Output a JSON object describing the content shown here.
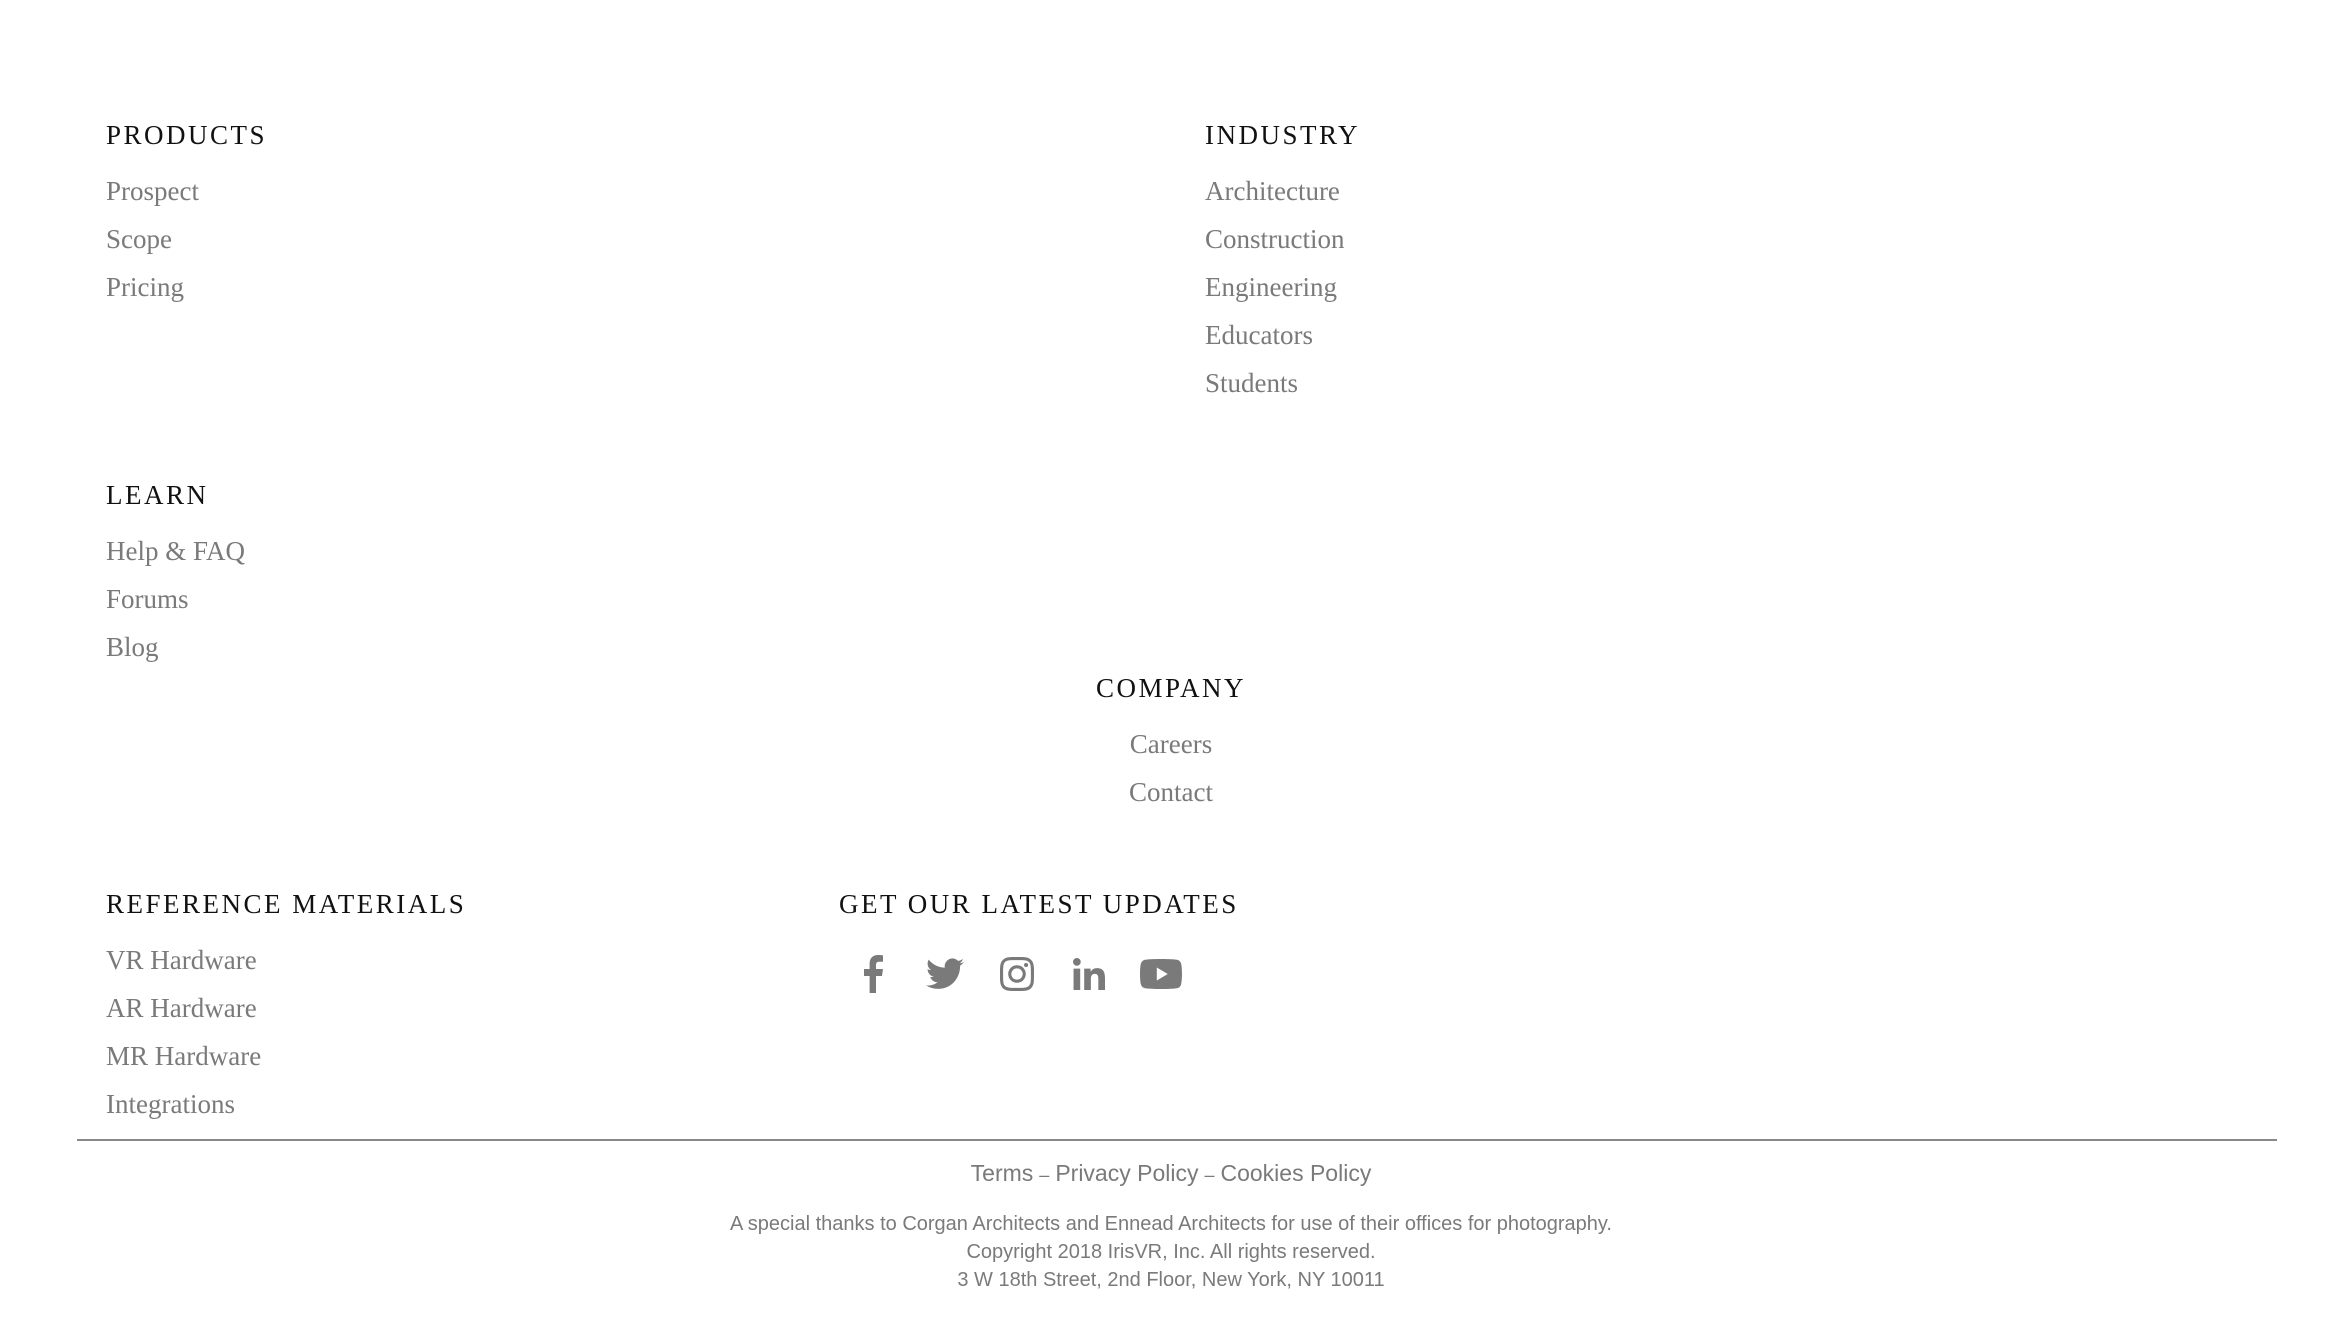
{
  "products": {
    "heading": "PRODUCTS",
    "links": [
      "Prospect",
      "Scope",
      "Pricing"
    ]
  },
  "industry": {
    "heading": "INDUSTRY",
    "links": [
      "Architecture",
      "Construction",
      "Engineering",
      "Educators",
      "Students"
    ]
  },
  "learn": {
    "heading": "LEARN",
    "links": [
      "Help & FAQ",
      "Forums",
      "Blog"
    ]
  },
  "company": {
    "heading": "COMPANY",
    "links": [
      "Careers",
      "Contact"
    ]
  },
  "reference": {
    "heading": "REFERENCE MATERIALS",
    "links": [
      "VR Hardware",
      "AR Hardware",
      "MR Hardware",
      "Integrations"
    ]
  },
  "updates": {
    "heading": "GET OUR LATEST UPDATES",
    "social": [
      "facebook-icon",
      "twitter-icon",
      "instagram-icon",
      "linkedin-icon",
      "youtube-icon"
    ]
  },
  "legal": {
    "terms": "Terms",
    "privacy": "Privacy Policy",
    "cookies": "Cookies Policy",
    "separator": "–"
  },
  "footer_text": {
    "thanks": "A special thanks to Corgan Architects and Ennead Architects for use of their offices for photography.",
    "copyright": "Copyright 2018 IrisVR, Inc. All rights reserved.",
    "address": "3 W 18th Street, 2nd Floor, New York, NY 10011"
  },
  "colors": {
    "heading": "#111111",
    "link": "#7a7a7a",
    "divider": "#888888"
  }
}
